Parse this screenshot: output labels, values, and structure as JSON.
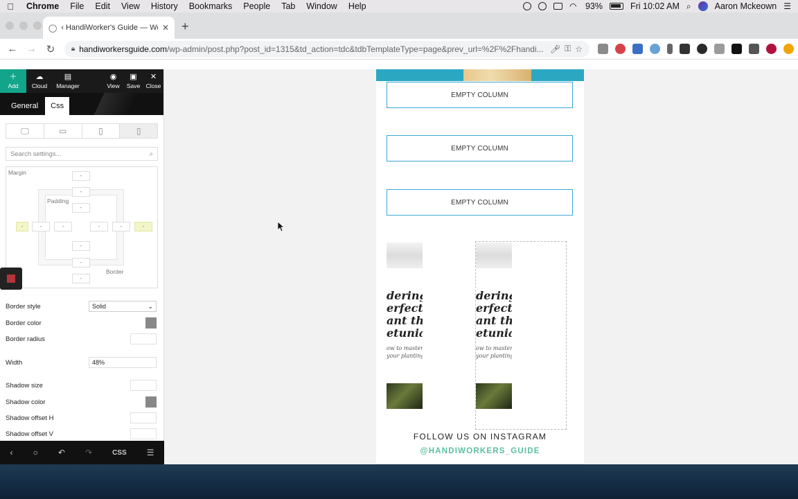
{
  "menubar": {
    "app": "Chrome",
    "items": [
      "File",
      "Edit",
      "View",
      "History",
      "Bookmarks",
      "People",
      "Tab",
      "Window",
      "Help"
    ],
    "battery": "93%",
    "clock": "Fri 10:02 AM",
    "user": "Aaron Mckeown"
  },
  "browser": {
    "tab_title": "‹ HandiWorker's Guide — Word",
    "url_domain": "handiworkersguide.com",
    "url_path": "/wp-admin/post.php?post_id=1315&td_action=tdc&tdbTemplateType=page&prev_url=%2F%2Fhandi..."
  },
  "panel": {
    "top_buttons": [
      {
        "label": "Add",
        "icon": "plus-icon"
      },
      {
        "label": "Cloud",
        "icon": "cloud-icon"
      },
      {
        "label": "Manager",
        "icon": "manager-icon"
      },
      {
        "label": "View",
        "icon": "eye-icon"
      },
      {
        "label": "Save",
        "icon": "save-icon"
      },
      {
        "label": "Close",
        "icon": "close-icon"
      }
    ],
    "tabs": [
      "General",
      "Css"
    ],
    "search_placeholder": "Search settings...",
    "box_model": {
      "margin_label": "Margin",
      "padding_label": "Padding",
      "border_label": "Border",
      "placeholder": "-"
    },
    "properties": {
      "border_style_label": "Border style",
      "border_style_value": "Solid",
      "border_color_label": "Border color",
      "border_radius_label": "Border radius",
      "width_label": "Width",
      "width_value": "48%",
      "shadow_size_label": "Shadow size",
      "shadow_color_label": "Shadow color",
      "shadow_offset_h_label": "Shadow offset H",
      "shadow_offset_v_label": "Shadow offset V"
    },
    "bottom_css_label": "CSS"
  },
  "preview": {
    "empty_columns": [
      "EMPTY COLUMN",
      "EMPTY COLUMN",
      "EMPTY COLUMN"
    ],
    "ig_text_lines": [
      "dering w",
      "erfect ti",
      "ant tho",
      "etunias"
    ],
    "ig_sub_lines": [
      "ow to master t",
      "your planting"
    ],
    "follow_label": "FOLLOW US ON INSTAGRAM",
    "handle": "@HANDIWORKERS_GUIDE"
  },
  "colors": {
    "accent_green": "#12a58a",
    "column_border": "#3aa8d8",
    "handle_teal": "#5bbfa0"
  }
}
